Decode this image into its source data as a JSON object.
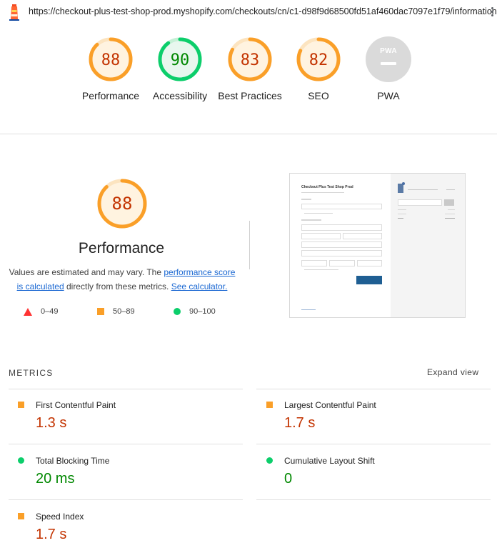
{
  "top_bar": {
    "url": "https://checkout-plus-test-shop-prod.myshopify.com/checkouts/cn/c1-d98f9d68500fd51af460dac7097e1f79/information"
  },
  "categories": [
    {
      "label": "Performance",
      "score": "88",
      "color": "#fa9f28",
      "text_color": "#c33300",
      "bg": "#fff3e0"
    },
    {
      "label": "Accessibility",
      "score": "90",
      "color": "#0cce6b",
      "text_color": "#008800",
      "bg": "#e8f7ee"
    },
    {
      "label": "Best Practices",
      "score": "83",
      "color": "#fa9f28",
      "text_color": "#c33300",
      "bg": "#fff3e0"
    },
    {
      "label": "SEO",
      "score": "82",
      "color": "#fa9f28",
      "text_color": "#c33300",
      "bg": "#fff3e0"
    },
    {
      "label": "PWA",
      "score": "PWA",
      "color": "#cccccc",
      "text_color": "#ffffff",
      "bg": "#dadada"
    }
  ],
  "performance_section": {
    "score": "88",
    "title": "Performance",
    "desc_before": "Values are estimated and may vary. The ",
    "link_score": "performance score is calculated",
    "desc_middle": " directly from these metrics. ",
    "link_calc": "See calculator."
  },
  "legend": [
    {
      "range": "0–49",
      "shape": "triangle",
      "color": "#ff3333"
    },
    {
      "range": "50–89",
      "shape": "square",
      "color": "#fa9f28"
    },
    {
      "range": "90–100",
      "shape": "circle",
      "color": "#0cce6b"
    }
  ],
  "screenshot_thumb": {
    "title": "Checkout Plus Test Shop Prod"
  },
  "metrics": {
    "heading": "METRICS",
    "expand_label": "Expand view",
    "items": [
      {
        "title": "First Contentful Paint",
        "value": "1.3 s",
        "status": "average",
        "color": "#c33300",
        "icon_color": "#fa9f28",
        "icon": "square"
      },
      {
        "title": "Largest Contentful Paint",
        "value": "1.7 s",
        "status": "average",
        "color": "#c33300",
        "icon_color": "#fa9f28",
        "icon": "square"
      },
      {
        "title": "Total Blocking Time",
        "value": "20 ms",
        "status": "pass",
        "color": "#008800",
        "icon_color": "#0cce6b",
        "icon": "circle"
      },
      {
        "title": "Cumulative Layout Shift",
        "value": "0",
        "status": "pass",
        "color": "#008800",
        "icon_color": "#0cce6b",
        "icon": "circle"
      },
      {
        "title": "Speed Index",
        "value": "1.7 s",
        "status": "average",
        "color": "#c33300",
        "icon_color": "#fa9f28",
        "icon": "square"
      }
    ]
  }
}
